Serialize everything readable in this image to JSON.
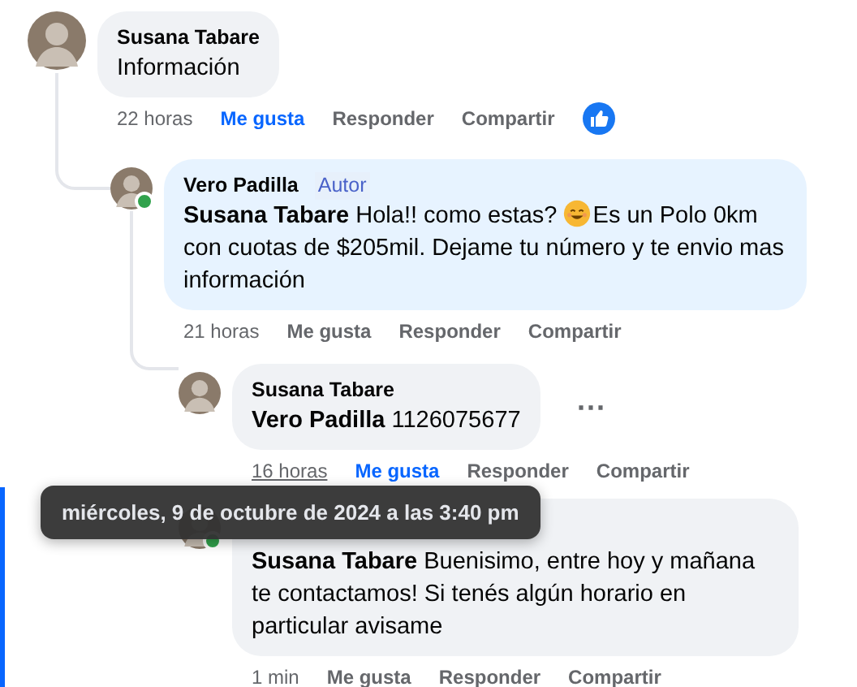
{
  "comments": [
    {
      "author": "Susana Tabare",
      "parts": [
        {
          "kind": "text",
          "text": "Información"
        }
      ],
      "time": "22 horas",
      "time_hovered": false,
      "like": "Me gusta",
      "liked": true,
      "reply": "Responder",
      "share": "Compartir",
      "like_reaction": true,
      "replies": [
        {
          "author": "Vero Padilla",
          "badge": "Autor",
          "online": true,
          "mention": "Susana Tabare",
          "parts": [
            {
              "kind": "text",
              "text": "Hola!! como estas? "
            },
            {
              "kind": "emoji"
            },
            {
              "kind": "text",
              "text": "Es un Polo 0km con cuotas de $205mil. Dejame tu número y te envio mas información"
            }
          ],
          "time": "21 horas",
          "time_hovered": false,
          "like": "Me gusta",
          "liked": false,
          "reply": "Responder",
          "share": "Compartir",
          "replies": [
            {
              "author": "Susana Tabare",
              "mention": "Vero Padilla",
              "parts": [
                {
                  "kind": "text",
                  "text": "1126075677"
                }
              ],
              "time": "16 horas",
              "time_hovered": true,
              "like": "Me gusta",
              "liked": true,
              "reply": "Responder",
              "share": "Compartir",
              "more_menu": "⋯"
            },
            {
              "online": true,
              "mention": "Susana Tabare",
              "parts": [
                {
                  "kind": "text",
                  "text": "Buenisimo, entre hoy y mañana te contactamos! Si tenés algún horario en particular avisame"
                }
              ],
              "time": "1 min",
              "time_hovered": false,
              "like": "Me gusta",
              "liked": false,
              "reply": "Responder",
              "share": "Compartir"
            }
          ]
        }
      ]
    }
  ],
  "tooltip": {
    "text": "miércoles, 9 de octubre de 2024 a las 3:40 pm"
  }
}
